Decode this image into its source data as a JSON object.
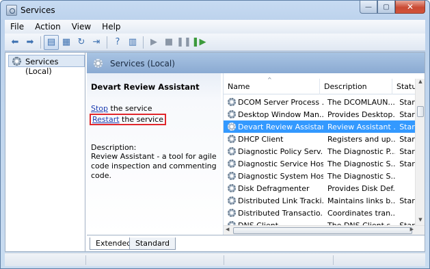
{
  "window": {
    "title": "Services",
    "minimize": "—",
    "maximize": "▢",
    "close": "✕"
  },
  "menu": [
    "File",
    "Action",
    "View",
    "Help"
  ],
  "toolbar": {
    "icons": [
      "back-arrow-icon",
      "forward-arrow-icon",
      "console-tree-icon",
      "properties-icon",
      "refresh-icon",
      "export-icon",
      "help-icon",
      "mmc-icon",
      "start-icon",
      "stop-icon",
      "pause-icon",
      "restart-icon"
    ]
  },
  "tree": {
    "root_label": "Services (Local)"
  },
  "pane": {
    "header_title": "Services (Local)",
    "selected_service": "Devart Review Assistant",
    "stop_link": "Stop",
    "stop_suffix": " the service",
    "restart_link": "Restart",
    "restart_suffix": " the service",
    "description_label": "Description:",
    "description_text": "Review Assistant - a tool for agile code inspection and commenting code."
  },
  "list": {
    "columns": {
      "name": "Name",
      "description": "Description",
      "status": "Status"
    },
    "rows": [
      {
        "name": "DCOM Server Process ...",
        "description": "The DCOMLAUN...",
        "status": "Starte"
      },
      {
        "name": "Desktop Window Man...",
        "description": "Provides Desktop...",
        "status": "Starte"
      },
      {
        "name": "Devart Review Assistant",
        "description": "Review Assistant ...",
        "status": "Starte"
      },
      {
        "name": "DHCP Client",
        "description": "Registers and up...",
        "status": "Starte"
      },
      {
        "name": "Diagnostic Policy Serv...",
        "description": "The Diagnostic P...",
        "status": "Starte"
      },
      {
        "name": "Diagnostic Service Host",
        "description": "The Diagnostic S...",
        "status": "Starte"
      },
      {
        "name": "Diagnostic System Host",
        "description": "The Diagnostic S...",
        "status": ""
      },
      {
        "name": "Disk Defragmenter",
        "description": "Provides Disk Def...",
        "status": ""
      },
      {
        "name": "Distributed Link Tracki...",
        "description": "Maintains links b...",
        "status": "Starte"
      },
      {
        "name": "Distributed Transactio...",
        "description": "Coordinates tran...",
        "status": ""
      },
      {
        "name": "DNS Client",
        "description": "The DNS Client s...",
        "status": "Starte"
      }
    ]
  },
  "tabs": {
    "extended": "Extended",
    "standard": "Standard"
  },
  "colors": {
    "selection": "#3399ff",
    "highlight_box": "#e0262b",
    "header": "#8aaad2"
  }
}
